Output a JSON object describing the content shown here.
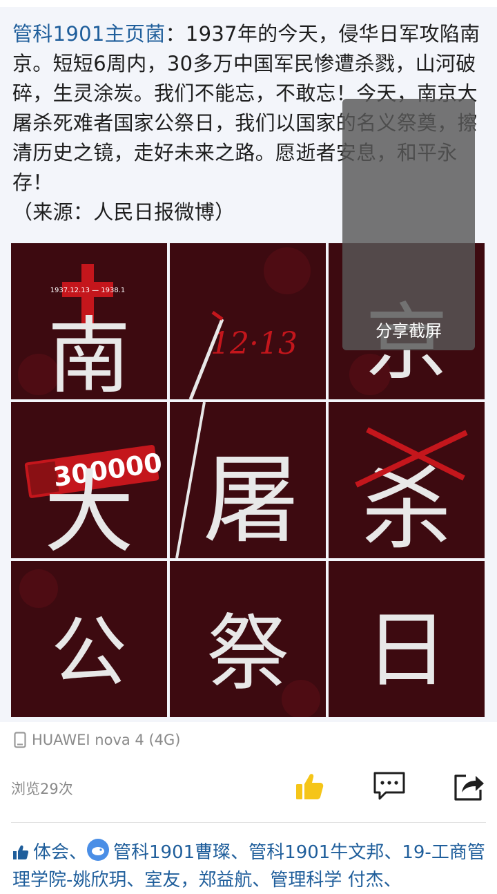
{
  "post": {
    "author": "管科1901主页菌",
    "colon": "：",
    "body": "1937年的今天，侵华日军攻陷南京。短短6周内，30多万中国军民惨遭杀戮，山河破碎，生灵涂炭。我们不能忘，不敢忘！今天，南京大屠杀死难者国家公祭日，我们以国家的名义祭奠，擦清历史之镜，走好未来之路。愿逝者安息，和平永存！",
    "source": "（来源：人民日报微博）"
  },
  "grid_images": [
    {
      "char": "南",
      "extra": "1937.12.13 — 1938.1"
    },
    {
      "char": "",
      "extra": "12·13"
    },
    {
      "char": "京",
      "extra": ""
    },
    {
      "char": "大",
      "extra": "300000"
    },
    {
      "char": "屠",
      "extra": ""
    },
    {
      "char": "杀",
      "extra": ""
    },
    {
      "char": "公",
      "extra": ""
    },
    {
      "char": "祭",
      "extra": ""
    },
    {
      "char": "日",
      "extra": ""
    }
  ],
  "overlay": {
    "label": "分享截屏"
  },
  "device": {
    "icon": "phone-icon",
    "label": "HUAWEI nova 4 (4G)"
  },
  "stats": {
    "views": "浏览29次"
  },
  "actions": [
    {
      "name": "like",
      "icon": "thumbs-up-icon"
    },
    {
      "name": "comment",
      "icon": "comment-icon"
    },
    {
      "name": "share",
      "icon": "share-icon"
    }
  ],
  "likes": {
    "prefix": "体会、",
    "names_line": "管科1901曹璨、管科1901牛文邦、19-工商管理学院-姚欣玥、室友，郑益航、管理科学 付杰、"
  },
  "colors": {
    "accent": "#1f5e9b",
    "like": "#f5c518",
    "image_bg": "#3d0a10",
    "blood": "#c4161c"
  }
}
